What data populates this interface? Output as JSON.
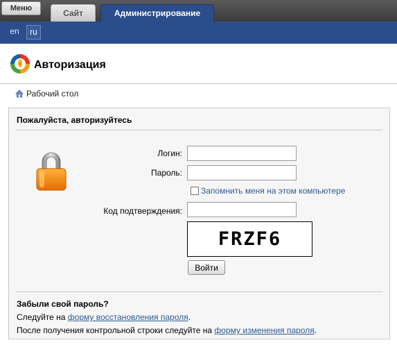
{
  "topbar": {
    "menu_label": "Меню",
    "tabs": [
      {
        "label": "Сайт"
      },
      {
        "label": "Администрирование"
      }
    ]
  },
  "languages": {
    "items": [
      "en",
      "ru"
    ],
    "selected": "ru"
  },
  "header": {
    "title": "Авторизация"
  },
  "breadcrumb": {
    "home_label": "Рабочий стол"
  },
  "auth_form": {
    "title": "Пожалуйста, авторизуйтесь",
    "login_label": "Логин:",
    "login_value": "",
    "password_label": "Пароль:",
    "password_value": "",
    "remember_label": "Запомнить меня на этом компьютере",
    "remember_checked": false,
    "code_label": "Код подтверждения:",
    "code_value": "",
    "captcha_text": "FRZF6",
    "submit_label": "Войти"
  },
  "forgot": {
    "title": "Забыли свой пароль?",
    "line1_prefix": "Следуйте на ",
    "line1_link": "форму восстановления пароля",
    "line1_suffix": ".",
    "line2_prefix": "После получения контрольной строки следуйте на ",
    "line2_link": "форму изменения пароля",
    "line2_suffix": "."
  },
  "colors": {
    "accent_blue": "#2b4d8c",
    "link": "#2f5a93"
  }
}
